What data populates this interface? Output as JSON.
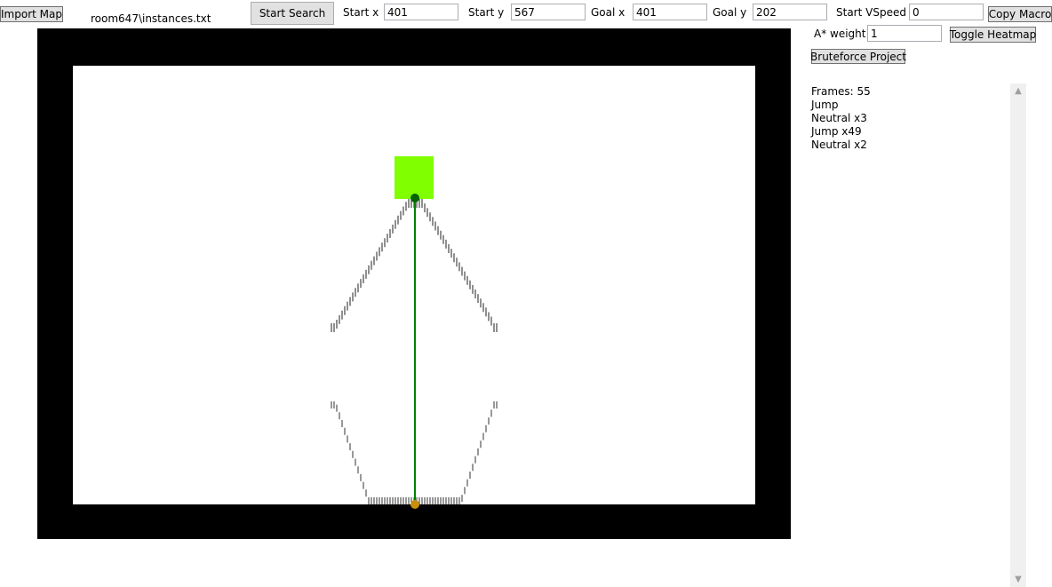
{
  "toolbar": {
    "import_label": "Import Map",
    "file_path": "room647\\instances.txt",
    "start_search_label": "Start Search",
    "start_x_label": "Start x",
    "start_x_value": "401",
    "start_y_label": "Start y",
    "start_y_value": "567",
    "goal_x_label": "Goal x",
    "goal_x_value": "401",
    "goal_y_label": "Goal y",
    "goal_y_value": "202",
    "start_vspeed_label": "Start VSpeed",
    "start_vspeed_value": "0",
    "copy_macro_label": "Copy Macro",
    "astar_weight_label": "A* weight",
    "astar_weight_value": "1",
    "toggle_heatmap_label": "Toggle Heatmap",
    "bruteforce_label": "Bruteforce Project"
  },
  "result": {
    "lines": [
      "Frames: 55",
      "Jump",
      "Neutral x3",
      "Jump x49",
      "Neutral x2"
    ]
  },
  "map": {
    "border_color": "#000000",
    "floor_color": "#ffffff",
    "goal_color": "#7fff00",
    "path_color": "#008000",
    "start_marker_color": "#c8900a",
    "goal_marker_color": "#006400",
    "heat_top_color": "#7a5a8a",
    "heat_mid_color": "#3a9ac8",
    "heat_low_color": "#e8f4ff"
  },
  "scrollbar": {
    "up_icon": "▲",
    "down_icon": "▼"
  }
}
